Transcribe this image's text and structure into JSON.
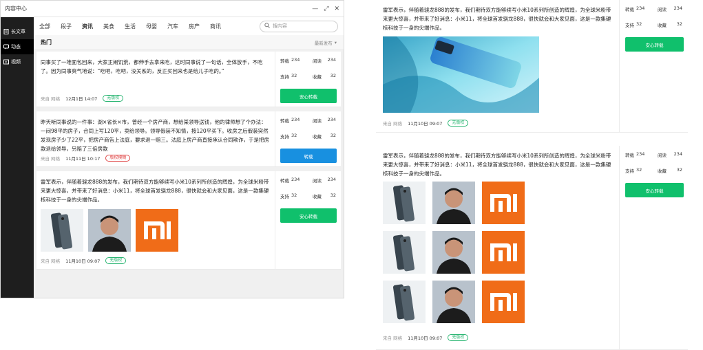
{
  "window": {
    "title": "内容中心"
  },
  "sidebar": {
    "items": [
      {
        "label": "长文章",
        "icon": "document-icon",
        "active": false
      },
      {
        "label": "动态",
        "icon": "chat-icon",
        "active": true
      },
      {
        "label": "视频",
        "icon": "video-icon",
        "active": false
      }
    ]
  },
  "tabs": [
    {
      "label": "全部"
    },
    {
      "label": "段子"
    },
    {
      "label": "资讯"
    },
    {
      "label": "美食"
    },
    {
      "label": "生活"
    },
    {
      "label": "母婴"
    },
    {
      "label": "汽车"
    },
    {
      "label": "房产"
    },
    {
      "label": "商讯"
    }
  ],
  "search": {
    "placeholder": "搜内容"
  },
  "hot": {
    "title": "热门",
    "sort": "最新发布"
  },
  "labels": {
    "repost": "转载",
    "read": "阅读",
    "support": "支持",
    "collect": "收藏",
    "source": "来自 网络"
  },
  "cards": [
    {
      "text": "同事买了一堆面包回来，大家正闹饥荒，都伸手去拿来吃，这时同事说了一句话，全体放手，不吃了。因为同事爽气地说：“吃吧，吃吧，没关系的，反正买回来也是给儿子吃的。”",
      "time": "12月1日 14:07",
      "badge": "无版权",
      "repost": "234",
      "read": "234",
      "support": "32",
      "collect": "32",
      "button": "安心转载"
    },
    {
      "text": "昨天听同事说的一件事：湖×省长×市，曾经一个房产商，想给某领导送钱，他的律师想了个办法：一间98平的房子，合同上写120平，卖给领导。领导假装不知情，按120平买下。收房之后假装突然发现房子少了22平，把房产商告上法庭，要求退一赔三。法庭上房产商直接承认合同欺诈，于是把房款退给领导，另赔了三倍房款",
      "time": "11月11日 10:17",
      "badge": "版权模糊",
      "repost": "234",
      "read": "234",
      "support": "32",
      "collect": "32",
      "button": "转载"
    },
    {
      "text": "雷军表示，伴随着骁龙888的发布，我们期待双方能够续写小米10系列所创造的辉煌，为全球米粉带来更大惊喜，并带来了好消息：小米11，将全球首发骁龙888，很快就会和大家见面，这是一款集硬核科技于一身的尖端作品。",
      "time": "11月10日 09:07",
      "badge": "无版权",
      "repost": "234",
      "read": "234",
      "support": "32",
      "collect": "32",
      "button": "安心转载"
    }
  ],
  "previews": [
    {
      "text": "雷军表示，伴随着骁龙888的发布，我们期待双方能够续写小米10系列所创造的辉煌，为全球米粉带来更大惊喜，并带来了好消息：小米11，将全球首发骁龙888，很快就会和大家见面，这是一款集硬核科技于一身的尖端作品。",
      "time": "11月10日 09:07",
      "badge": "无版权",
      "repost": "234",
      "read": "234",
      "support": "32",
      "collect": "32",
      "button": "安心转载"
    },
    {
      "text": "雷军表示，伴随着骁龙888的发布，我们期待双方能够续写小米10系列所创造的辉煌，为全球米粉带来更大惊喜，并带来了好消息：小米11，将全球首发骁龙888，很快就会和大家见面，这是一款集硬核科技于一身的尖端作品。",
      "time": "11月10日 09:07",
      "badge": "无版权",
      "repost": "234",
      "read": "234",
      "support": "32",
      "collect": "32",
      "button": "安心转载"
    }
  ],
  "colors": {
    "accent_green": "#10c06c",
    "accent_blue": "#1890e0",
    "sidebar_bg": "#1e1e1e",
    "mi_orange": "#f06c18",
    "badge_red": "#e14d4d"
  }
}
